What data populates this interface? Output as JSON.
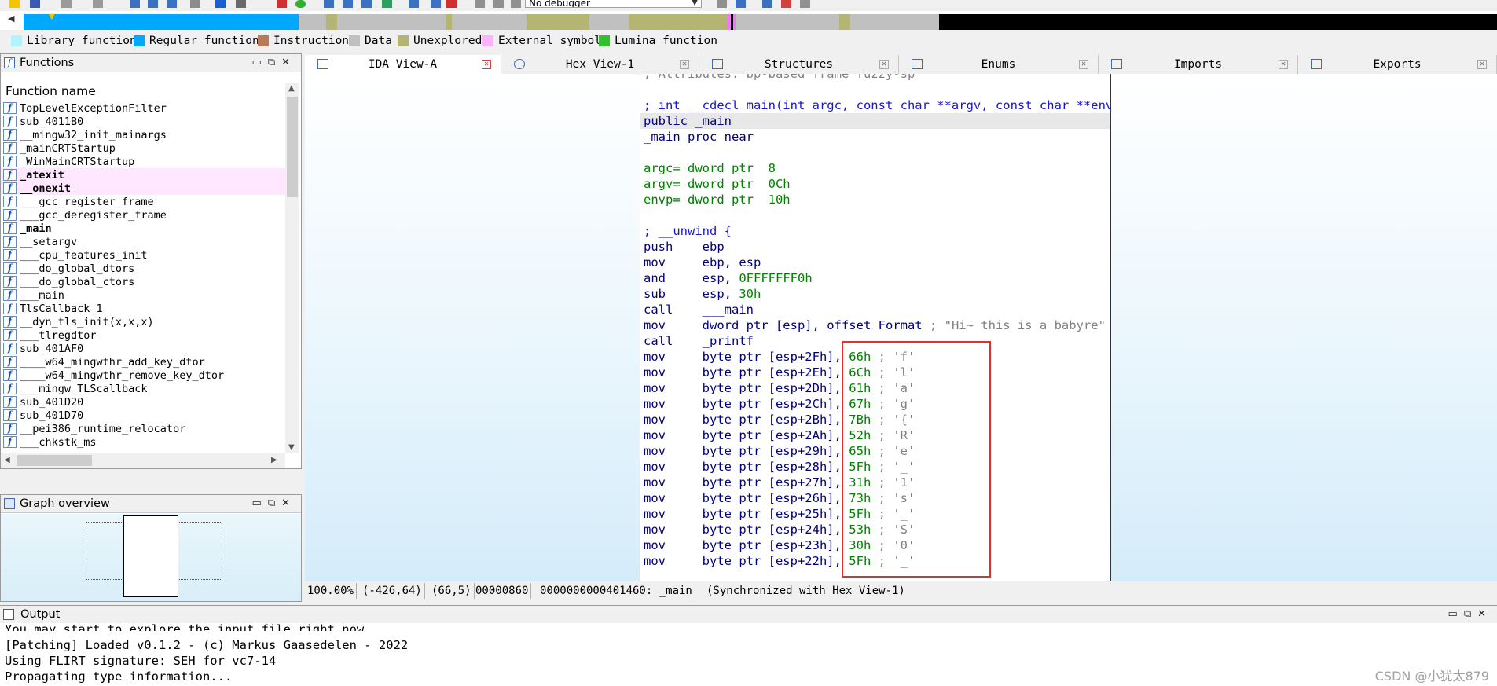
{
  "toolbar": {
    "debugger_select": "No debugger"
  },
  "navband": {
    "colors": {
      "library": "#a8f0ff",
      "regular": "#00a8ff",
      "instruction": "#b08060",
      "data": "#c0c0c0",
      "unexplored": "#b0b070",
      "external": "#ffb0ff",
      "lumina": "#30c030",
      "black": "#000000"
    }
  },
  "legend": [
    {
      "label": "Library function",
      "color": "#b0f4ff"
    },
    {
      "label": "Regular function",
      "color": "#00a8ff"
    },
    {
      "label": "Instruction",
      "color": "#b97a57"
    },
    {
      "label": "Data",
      "color": "#c0c0c0"
    },
    {
      "label": "Unexplored",
      "color": "#b5b573"
    },
    {
      "label": "External symbol",
      "color": "#ffb0ff"
    },
    {
      "label": "Lumina function",
      "color": "#30c030"
    }
  ],
  "functions_panel": {
    "title": "Functions",
    "column_header": "Function name",
    "items": [
      {
        "name": "TopLevelExceptionFilter",
        "style": ""
      },
      {
        "name": "sub_4011B0",
        "style": ""
      },
      {
        "name": "__mingw32_init_mainargs",
        "style": ""
      },
      {
        "name": "_mainCRTStartup",
        "style": ""
      },
      {
        "name": "_WinMainCRTStartup",
        "style": ""
      },
      {
        "name": "_atexit",
        "style": "lib"
      },
      {
        "name": "__onexit",
        "style": "lib"
      },
      {
        "name": "___gcc_register_frame",
        "style": ""
      },
      {
        "name": "___gcc_deregister_frame",
        "style": ""
      },
      {
        "name": "_main",
        "style": "bold"
      },
      {
        "name": "__setargv",
        "style": ""
      },
      {
        "name": "___cpu_features_init",
        "style": ""
      },
      {
        "name": "___do_global_dtors",
        "style": ""
      },
      {
        "name": "___do_global_ctors",
        "style": ""
      },
      {
        "name": "___main",
        "style": ""
      },
      {
        "name": "TlsCallback_1",
        "style": ""
      },
      {
        "name": "__dyn_tls_init(x,x,x)",
        "style": ""
      },
      {
        "name": "___tlregdtor",
        "style": ""
      },
      {
        "name": "sub_401AF0",
        "style": ""
      },
      {
        "name": "____w64_mingwthr_add_key_dtor",
        "style": ""
      },
      {
        "name": "____w64_mingwthr_remove_key_dtor",
        "style": ""
      },
      {
        "name": "___mingw_TLScallback",
        "style": ""
      },
      {
        "name": "sub_401D20",
        "style": ""
      },
      {
        "name": "sub_401D70",
        "style": ""
      },
      {
        "name": "__pei386_runtime_relocator",
        "style": ""
      },
      {
        "name": "___chkstk_ms",
        "style": ""
      }
    ]
  },
  "graph_overview": {
    "title": "Graph overview"
  },
  "tabs": [
    {
      "label": "IDA View-A",
      "active": true
    },
    {
      "label": "Hex View-1",
      "active": false
    },
    {
      "label": "Structures",
      "active": false
    },
    {
      "label": "Enums",
      "active": false
    },
    {
      "label": "Imports",
      "active": false
    },
    {
      "label": "Exports",
      "active": false
    }
  ],
  "code_lines": [
    {
      "segs": [
        {
          "t": "; Attributes: bp-based frame fuzzy-sp",
          "c": "c-cmt"
        }
      ]
    },
    {
      "segs": []
    },
    {
      "segs": [
        {
          "t": "; int __cdecl main(int argc, const char **argv, const char **envp)",
          "c": "c-blue"
        }
      ]
    },
    {
      "segs": [
        {
          "t": "public _main",
          "c": "c-navy"
        }
      ],
      "hl": true
    },
    {
      "segs": [
        {
          "t": "_main proc near",
          "c": "c-navy"
        }
      ]
    },
    {
      "segs": []
    },
    {
      "segs": [
        {
          "t": "argc= dword ptr  ",
          "c": "c-green"
        },
        {
          "t": "8",
          "c": "c-green"
        }
      ]
    },
    {
      "segs": [
        {
          "t": "argv= dword ptr  ",
          "c": "c-green"
        },
        {
          "t": "0Ch",
          "c": "c-green"
        }
      ]
    },
    {
      "segs": [
        {
          "t": "envp= dword ptr  ",
          "c": "c-green"
        },
        {
          "t": "10h",
          "c": "c-green"
        }
      ]
    },
    {
      "segs": []
    },
    {
      "segs": [
        {
          "t": "; __unwind {",
          "c": "c-blue"
        }
      ]
    },
    {
      "segs": [
        {
          "t": "push    ebp",
          "c": "c-navy"
        }
      ]
    },
    {
      "segs": [
        {
          "t": "mov     ebp, esp",
          "c": "c-navy"
        }
      ]
    },
    {
      "segs": [
        {
          "t": "and     esp, ",
          "c": "c-navy"
        },
        {
          "t": "0FFFFFFF0h",
          "c": "c-green"
        }
      ]
    },
    {
      "segs": [
        {
          "t": "sub     esp, ",
          "c": "c-navy"
        },
        {
          "t": "30h",
          "c": "c-green"
        }
      ]
    },
    {
      "segs": [
        {
          "t": "call    ___main",
          "c": "c-navy"
        }
      ]
    },
    {
      "segs": [
        {
          "t": "mov     dword ptr [esp], offset Format ",
          "c": "c-navy"
        },
        {
          "t": "; \"Hi~ this is a babyre\"",
          "c": "c-str"
        }
      ]
    },
    {
      "segs": [
        {
          "t": "call    _printf",
          "c": "c-navy"
        }
      ]
    },
    {
      "segs": [
        {
          "t": "mov     byte ptr [esp+2Fh], ",
          "c": "c-navy"
        },
        {
          "t": "66h",
          "c": "c-green"
        },
        {
          "t": " ; 'f'",
          "c": "c-str"
        }
      ]
    },
    {
      "segs": [
        {
          "t": "mov     byte ptr [esp+2Eh], ",
          "c": "c-navy"
        },
        {
          "t": "6Ch",
          "c": "c-green"
        },
        {
          "t": " ; 'l'",
          "c": "c-str"
        }
      ]
    },
    {
      "segs": [
        {
          "t": "mov     byte ptr [esp+2Dh], ",
          "c": "c-navy"
        },
        {
          "t": "61h",
          "c": "c-green"
        },
        {
          "t": " ; 'a'",
          "c": "c-str"
        }
      ]
    },
    {
      "segs": [
        {
          "t": "mov     byte ptr [esp+2Ch], ",
          "c": "c-navy"
        },
        {
          "t": "67h",
          "c": "c-green"
        },
        {
          "t": " ; 'g'",
          "c": "c-str"
        }
      ]
    },
    {
      "segs": [
        {
          "t": "mov     byte ptr [esp+2Bh], ",
          "c": "c-navy"
        },
        {
          "t": "7Bh",
          "c": "c-green"
        },
        {
          "t": " ; '{'",
          "c": "c-str"
        }
      ]
    },
    {
      "segs": [
        {
          "t": "mov     byte ptr [esp+2Ah], ",
          "c": "c-navy"
        },
        {
          "t": "52h",
          "c": "c-green"
        },
        {
          "t": " ; 'R'",
          "c": "c-str"
        }
      ]
    },
    {
      "segs": [
        {
          "t": "mov     byte ptr [esp+29h], ",
          "c": "c-navy"
        },
        {
          "t": "65h",
          "c": "c-green"
        },
        {
          "t": " ; 'e'",
          "c": "c-str"
        }
      ]
    },
    {
      "segs": [
        {
          "t": "mov     byte ptr [esp+28h], ",
          "c": "c-navy"
        },
        {
          "t": "5Fh",
          "c": "c-green"
        },
        {
          "t": " ; '_'",
          "c": "c-str"
        }
      ]
    },
    {
      "segs": [
        {
          "t": "mov     byte ptr [esp+27h], ",
          "c": "c-navy"
        },
        {
          "t": "31h",
          "c": "c-green"
        },
        {
          "t": " ; '1'",
          "c": "c-str"
        }
      ]
    },
    {
      "segs": [
        {
          "t": "mov     byte ptr [esp+26h], ",
          "c": "c-navy"
        },
        {
          "t": "73h",
          "c": "c-green"
        },
        {
          "t": " ; 's'",
          "c": "c-str"
        }
      ]
    },
    {
      "segs": [
        {
          "t": "mov     byte ptr [esp+25h], ",
          "c": "c-navy"
        },
        {
          "t": "5Fh",
          "c": "c-green"
        },
        {
          "t": " ; '_'",
          "c": "c-str"
        }
      ]
    },
    {
      "segs": [
        {
          "t": "mov     byte ptr [esp+24h], ",
          "c": "c-navy"
        },
        {
          "t": "53h",
          "c": "c-green"
        },
        {
          "t": " ; 'S'",
          "c": "c-str"
        }
      ]
    },
    {
      "segs": [
        {
          "t": "mov     byte ptr [esp+23h], ",
          "c": "c-navy"
        },
        {
          "t": "30h",
          "c": "c-green"
        },
        {
          "t": " ; '0'",
          "c": "c-str"
        }
      ]
    },
    {
      "segs": [
        {
          "t": "mov     byte ptr [esp+22h], ",
          "c": "c-navy"
        },
        {
          "t": "5Fh",
          "c": "c-green"
        },
        {
          "t": " ; '_'",
          "c": "c-str"
        }
      ]
    }
  ],
  "status_bar": {
    "zoom": "100.00%",
    "coords": "(-426,64)",
    "cursor": "(66,5)",
    "offset": "00000860",
    "address": "0000000000401460: _main",
    "sync": "(Synchronized with Hex View-1)"
  },
  "output_panel": {
    "title": "Output",
    "lines": [
      "You may start to explore the input file right now.",
      "[Patching] Loaded v0.1.2 - (c) Markus Gaasedelen - 2022",
      "Using FLIRT signature: SEH for vc7-14",
      "Propagating type information..."
    ]
  },
  "watermark": "CSDN @小犹太879"
}
